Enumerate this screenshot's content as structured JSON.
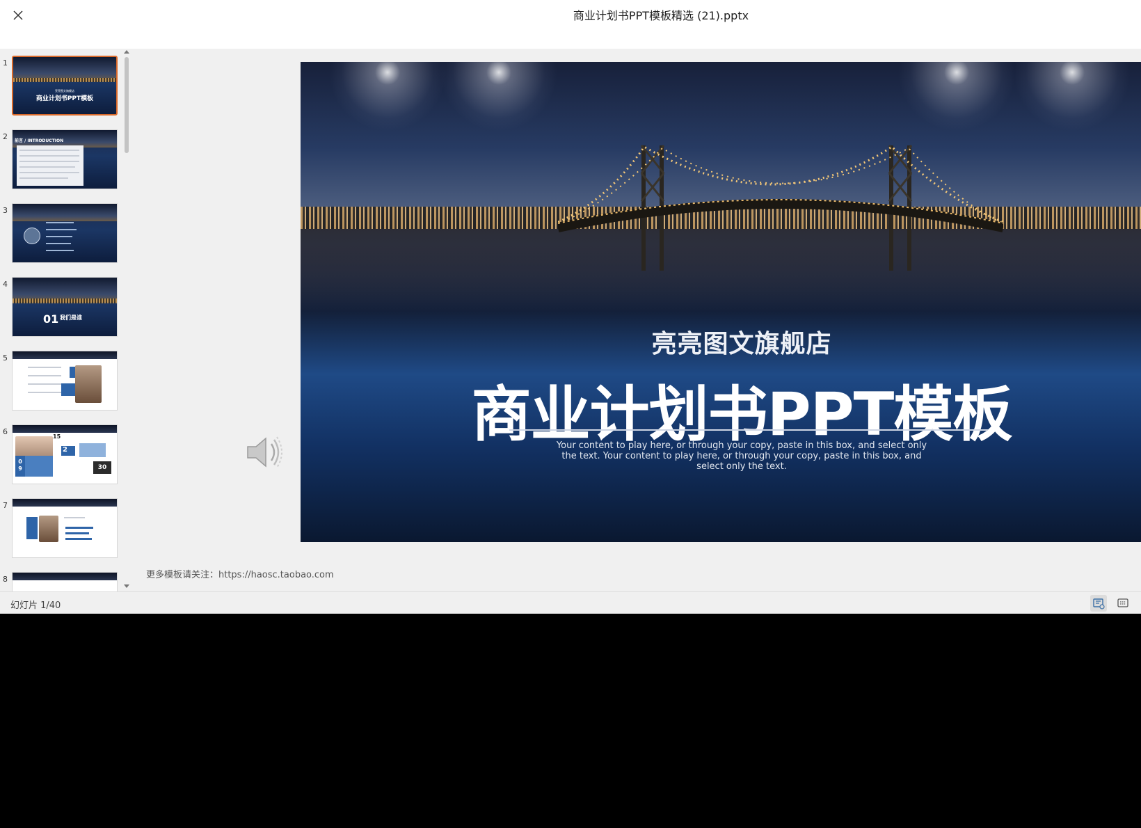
{
  "window": {
    "title": "商业计划书PPT模板精选 (21).pptx"
  },
  "sidebar": {
    "thumbnails": [
      {
        "number": "1",
        "title": "商业计划书PPT模板",
        "subtitle": "亮亮图文旗舰店"
      },
      {
        "number": "2",
        "title": "前言 / INTRODUCTION"
      },
      {
        "number": "3"
      },
      {
        "number": "4",
        "title": "01",
        "subtitle": "我们是谁"
      },
      {
        "number": "5"
      },
      {
        "number": "6",
        "stat_top": "15",
        "stat_side": "2",
        "stat_left": "0 9",
        "stat_box": "30"
      },
      {
        "number": "7"
      },
      {
        "number": "8"
      }
    ],
    "active_index": 0
  },
  "slide": {
    "subtitle": "亮亮图文旗舰店",
    "title": "商业计划书PPT模板",
    "body": "Your content to play here, or through your copy, paste in this box, and select only the text. Your content to play here, or through your copy, paste in this box, and select only the text."
  },
  "notes": {
    "text": "更多模板请关注：https://haosc.taobao.com"
  },
  "status": {
    "slide_counter": "幻灯片 1/40",
    "current_slide": 1,
    "total_slides": 40
  },
  "icons": {
    "close": "close-icon",
    "speaker": "speaker-icon",
    "notes_view": "notes-view-icon",
    "comments_view": "comments-view-icon"
  },
  "colors": {
    "active_thumbnail_border": "#d9692a",
    "slide_background_top": "#17203a",
    "slide_background_bottom": "#0a1830"
  }
}
